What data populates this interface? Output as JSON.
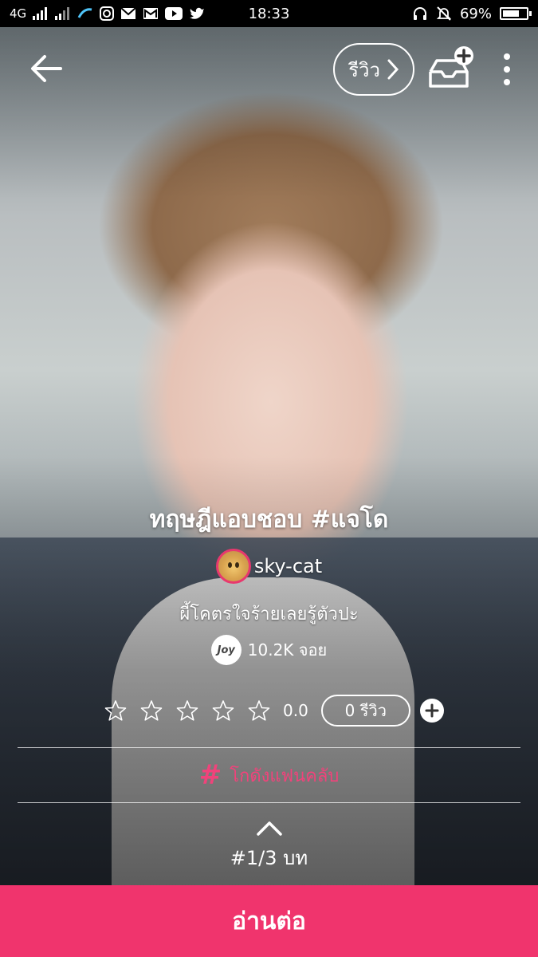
{
  "status_bar": {
    "network_1": "4G",
    "time": "18:33",
    "battery": "69%"
  },
  "top_nav": {
    "review_label": "รีวิว"
  },
  "story": {
    "title": "ทฤษฎีแอบชอบ #แจโด",
    "author": "sky-cat",
    "tagline": "ผี้โคตรใจร้ายเลยรู้ตัวปะ",
    "joy_badge": "Joy",
    "joy_count": "10.2K จอย",
    "rating_score": "0.0",
    "review_count": "0 รีวิว",
    "stars": [
      0,
      0,
      0,
      0,
      0
    ]
  },
  "fanclub": {
    "label": "โกดังแฟนคลับ"
  },
  "chapter": {
    "label": "#1/3 บท"
  },
  "read_button": {
    "label": "อ่านต่อ"
  },
  "colors": {
    "accent": "#f0346d",
    "fanclub": "#f0437b",
    "status_bar": "#000000"
  }
}
